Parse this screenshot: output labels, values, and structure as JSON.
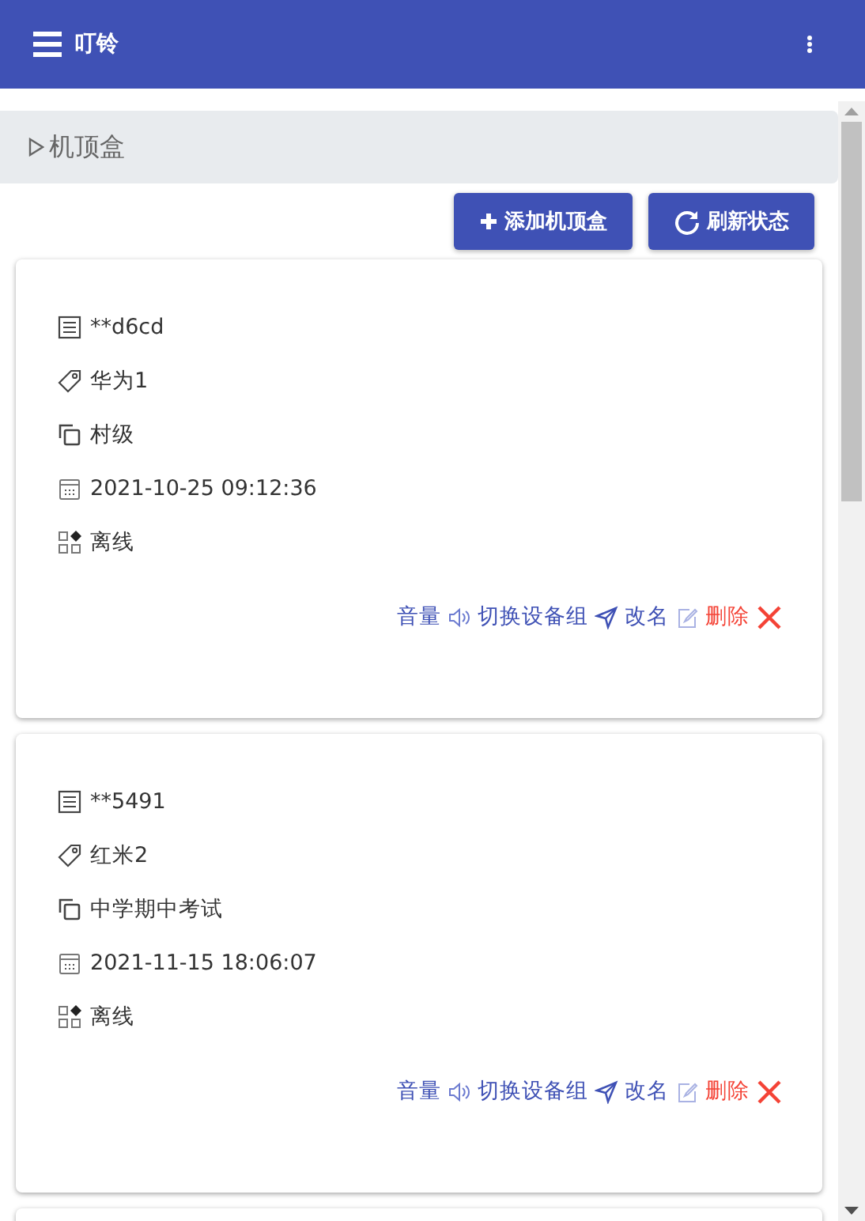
{
  "app_bar": {
    "title": "叮铃"
  },
  "section": {
    "title": "机顶盒"
  },
  "buttons": [
    {
      "kind": "add",
      "label": "添加机顶盒"
    },
    {
      "kind": "refresh",
      "label": "刷新状态"
    }
  ],
  "devices": [
    {
      "fields": [
        {
          "kind": "serial",
          "text": "**d6cd"
        },
        {
          "kind": "tag",
          "text": "华为1"
        },
        {
          "kind": "group",
          "text": "村级"
        },
        {
          "kind": "time",
          "text": "2021-10-25 09:12:36"
        },
        {
          "kind": "status",
          "text": "离线"
        }
      ],
      "actions": [
        {
          "kind": "volume",
          "label": "音量"
        },
        {
          "kind": "switch",
          "label": "切换设备组"
        },
        {
          "kind": "rename",
          "label": "改名"
        },
        {
          "kind": "delete",
          "label": "删除"
        }
      ]
    },
    {
      "fields": [
        {
          "kind": "serial",
          "text": "**5491"
        },
        {
          "kind": "tag",
          "text": "红米2"
        },
        {
          "kind": "group",
          "text": "中学期中考试"
        },
        {
          "kind": "time",
          "text": "2021-11-15 18:06:07"
        },
        {
          "kind": "status",
          "text": "离线"
        }
      ],
      "actions": [
        {
          "kind": "volume",
          "label": "音量"
        },
        {
          "kind": "switch",
          "label": "切换设备组"
        },
        {
          "kind": "rename",
          "label": "改名"
        },
        {
          "kind": "delete",
          "label": "删除"
        }
      ]
    }
  ]
}
